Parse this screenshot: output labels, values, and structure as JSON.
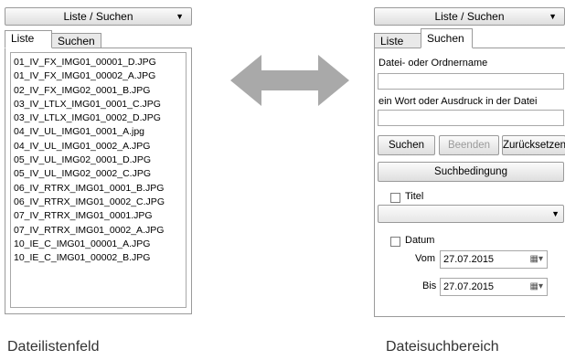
{
  "left": {
    "combo_label": "Liste / Suchen",
    "tabs": [
      "Liste",
      "Suchen"
    ],
    "files": [
      "01_IV_FX_IMG01_00001_D.JPG",
      "01_IV_FX_IMG01_00002_A.JPG",
      "02_IV_FX_IMG02_0001_B.JPG",
      "03_IV_LTLX_IMG01_0001_C.JPG",
      "03_IV_LTLX_IMG01_0002_D.JPG",
      "04_IV_UL_IMG01_0001_A.jpg",
      "04_IV_UL_IMG01_0002_A.JPG",
      "05_IV_UL_IMG02_0001_D.JPG",
      "05_IV_UL_IMG02_0002_C.JPG",
      "06_IV_RTRX_IMG01_0001_B.JPG",
      "06_IV_RTRX_IMG01_0002_C.JPG",
      "07_IV_RTRX_IMG01_0001.JPG",
      "07_IV_RTRX_IMG01_0002_A.JPG",
      "10_IE_C_IMG01_00001_A.JPG",
      "10_IE_C_IMG01_00002_B.JPG"
    ],
    "caption": "Dateilistenfeld"
  },
  "right": {
    "combo_label": "Liste / Suchen",
    "tabs": [
      "Liste",
      "Suchen"
    ],
    "name_label": "Datei- oder Ordnername",
    "name_value": "",
    "word_label": "ein Wort oder Ausdruck in der Datei",
    "word_value": "",
    "buttons": {
      "search": "Suchen",
      "stop": "Beenden",
      "reset": "Zurücksetzen"
    },
    "condition_button": "Suchbedingung",
    "title_label": "Titel",
    "title_select_value": "",
    "date_label": "Datum",
    "from_label": "Vom",
    "from_value": "27.07.2015",
    "to_label": "Bis",
    "to_value": "27.07.2015",
    "caption": "Dateisuchbereich"
  },
  "colors": {
    "arrow": "#a9a9a9",
    "border": "#9a9a9a",
    "disabled_text": "#9a9a9a"
  },
  "icons": {
    "dropdown": "chevron-down-icon",
    "calendar": "calendar-icon",
    "double_arrow": "double-arrow-icon"
  }
}
